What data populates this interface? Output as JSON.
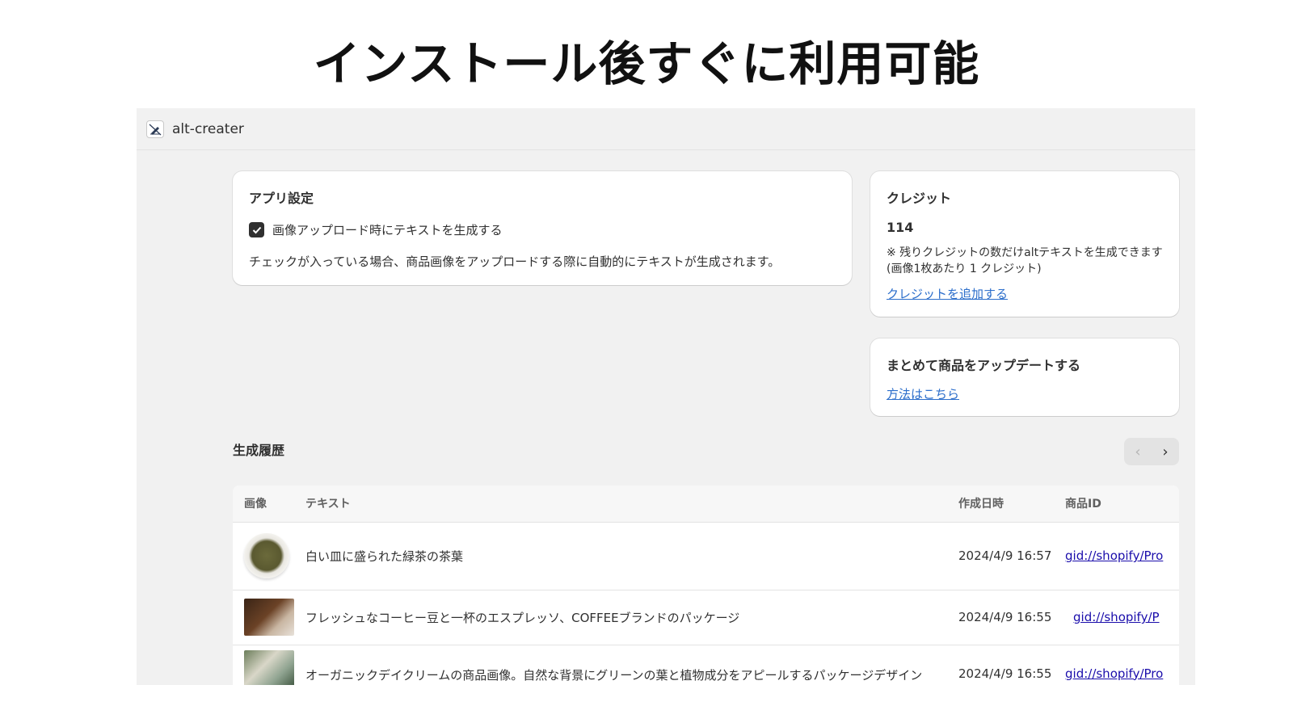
{
  "hero": {
    "title": "インストール後すぐに利用可能"
  },
  "app": {
    "name": "alt-creater",
    "icon": "pen-slash-icon"
  },
  "settings": {
    "title": "アプリ設定",
    "checkbox_label": "画像アップロード時にテキストを生成する",
    "checkbox_checked": true,
    "help_text": "チェックが入っている場合、商品画像をアップロードする際に自動的にテキストが生成されます。"
  },
  "credit": {
    "title": "クレジット",
    "value": "114",
    "note": "※ 残りクレジットの数だけaltテキストを生成できます(画像1枚あたり 1 クレジット)",
    "link": "クレジットを追加する"
  },
  "bulk": {
    "title": "まとめて商品をアップデートする",
    "link": "方法はこちら"
  },
  "history": {
    "title": "生成履歴",
    "pager": {
      "prev": "‹",
      "next": "›"
    },
    "columns": [
      "画像",
      "テキスト",
      "作成日時",
      "商品ID"
    ],
    "rows": [
      {
        "image": "green-tea-leaves-thumbnail",
        "text": "白い皿に盛られた緑茶の茶葉",
        "created": "2024/4/9 16:57",
        "product_id": "gid://shopify/Pro"
      },
      {
        "image": "coffee-package-thumbnail",
        "text": "フレッシュなコーヒー豆と一杯のエスプレッソ、COFFEEブランドのパッケージ",
        "created": "2024/4/9 16:55",
        "product_id": "gid://shopify/P"
      },
      {
        "image": "day-cream-thumbnail",
        "text": "オーガニックデイクリームの商品画像。自然な背景にグリーンの葉と植物成分をアピールするパッケージデザイン",
        "created": "2024/4/9 16:55",
        "product_id": "gid://shopify/Pro"
      }
    ]
  },
  "colors": {
    "link": "#2c6ecb",
    "frame_bg": "#f1f1f1",
    "card_bg": "#ffffff",
    "checkbox": "#303030"
  }
}
